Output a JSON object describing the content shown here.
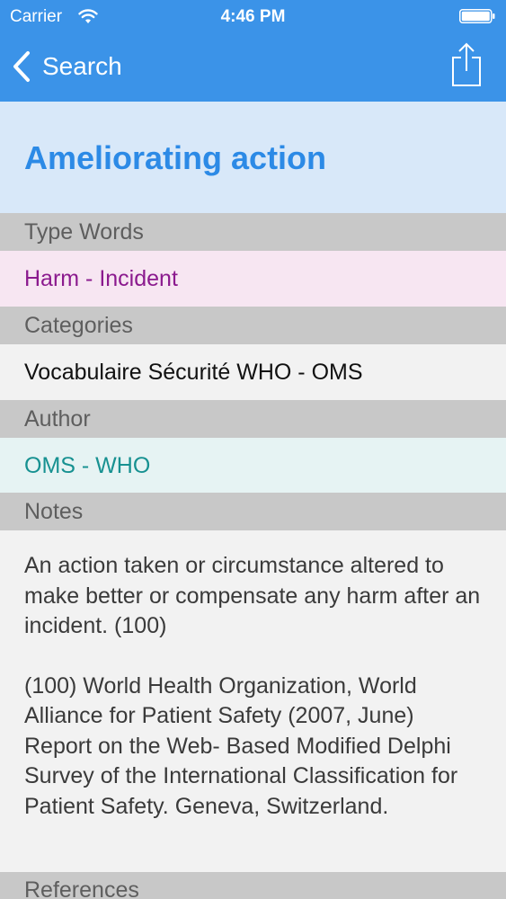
{
  "status_bar": {
    "carrier": "Carrier",
    "time": "4:46 PM",
    "icons": [
      "wifi-icon",
      "battery-icon"
    ]
  },
  "nav": {
    "back_label": "Search",
    "back_icon": "chevron-left-icon",
    "share_icon": "share-icon"
  },
  "entry": {
    "title": "Ameliorating action"
  },
  "sections": {
    "type_words": {
      "header": "Type Words",
      "value": "Harm - Incident"
    },
    "categories": {
      "header": "Categories",
      "value": "Vocabulaire Sécurité WHO - OMS"
    },
    "author": {
      "header": "Author",
      "value": "OMS - WHO"
    },
    "notes": {
      "header": "Notes",
      "paragraph1": "An action taken or circumstance altered to make better or compensate any harm after an incident. (100)",
      "paragraph2": "(100) World Health Organization, World Alliance for Patient Safety (2007, June) Report on the Web- Based Modified Delphi Survey of the International Classification for Patient Safety. Geneva, Switzerland."
    },
    "references": {
      "header": "References"
    }
  },
  "colors": {
    "accent": "#3b93e8",
    "title": "#2c8ae6",
    "type_words_text": "#8b1a8e",
    "author_text": "#179191",
    "section_header_bg": "#c8c8c8"
  }
}
